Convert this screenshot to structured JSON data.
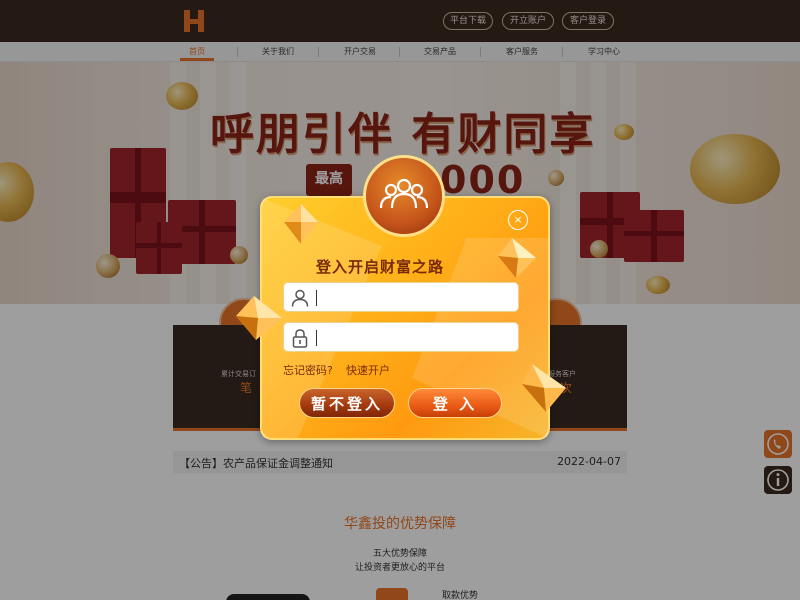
{
  "header": {
    "logo_letter": "H",
    "buttons": [
      "平台下载",
      "开立账户",
      "客户登录"
    ]
  },
  "nav": {
    "items": [
      "首页",
      "关于我们",
      "开户交易",
      "交易产品",
      "客户服务",
      "学习中心"
    ],
    "active_index": 0
  },
  "banner": {
    "title": "呼朋引伴 有财同享",
    "badge": "最高",
    "amount_visible": "000"
  },
  "stats": {
    "label_left": "累计交易订",
    "value_left": "笔",
    "label_right": "服务客户",
    "value_right": "次"
  },
  "notice": {
    "text": "【公告】农产品保证金调整通知",
    "date": "2022-04-07"
  },
  "section": {
    "title": "华鑫投的优势保障",
    "subtitle_1": "五大优势保障",
    "subtitle_2": "让投资者更放心的平台",
    "advantage_item": "取款优势"
  },
  "modal": {
    "close_symbol": "×",
    "title": "登入开启财富之路",
    "username_value": "",
    "password_value": "",
    "forgot_password": "忘记密码?",
    "quick_open": "快速开户",
    "skip_button": "暂不登入",
    "login_button": "登 入"
  },
  "icons": {
    "avatar": "group-users-icon",
    "user": "user-icon",
    "lock": "lock-icon",
    "phone": "phone-icon",
    "info": "info-icon"
  },
  "colors": {
    "accent": "#e8742a",
    "header_bg": "#3a2a20",
    "modal_orange": "#ffb21a",
    "title_brown": "#7a2a08"
  }
}
